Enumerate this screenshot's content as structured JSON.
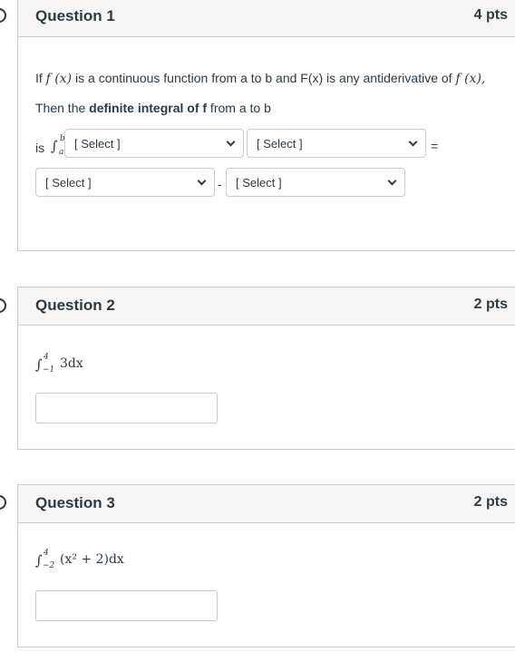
{
  "questions": [
    {
      "title": "Question 1",
      "points": "4 pts",
      "text": {
        "if": "If",
        "f_x_1": "f (x)",
        "middle": " is a continuous function from a to b and F(x) is any antiderivative of ",
        "f_x_2": "f (x),",
        "then_prefix": "Then the ",
        "then_bold": "definite integral of f",
        "then_suffix": " from a to b",
        "is": "is",
        "integral": "∫",
        "upper": "b",
        "lower": "a",
        "equals": "=",
        "minus": "-"
      },
      "selects": [
        {
          "selected": "[ Select ]"
        },
        {
          "selected": "[ Select ]"
        },
        {
          "selected": "[ Select ]"
        },
        {
          "selected": "[ Select ]"
        }
      ]
    },
    {
      "title": "Question 2",
      "points": "2 pts",
      "integral": "∫",
      "upper": "4",
      "lower": "−1",
      "integrand": "3dx",
      "answer_value": ""
    },
    {
      "title": "Question 3",
      "points": "2 pts",
      "integral": "∫",
      "upper": "4",
      "lower": "−2",
      "integrand": "(x² + 2)dx",
      "answer_value": ""
    }
  ]
}
